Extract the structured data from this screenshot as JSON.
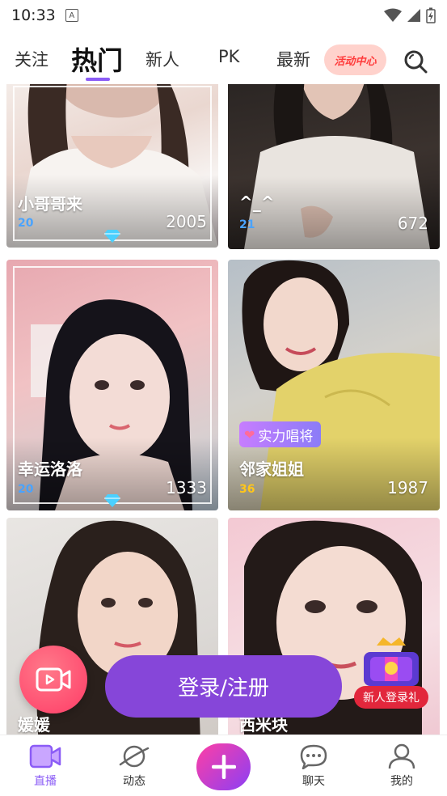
{
  "status": {
    "time": "10:33",
    "a_icon": "A"
  },
  "nav": {
    "tabs": [
      "关注",
      "热门",
      "新人",
      "PK",
      "最新"
    ],
    "active_tab": "热门",
    "event_label": "活动中心"
  },
  "cards": [
    {
      "name": "小哥哥来",
      "level": "20",
      "viewers": "2005",
      "level_color": "#4aa3ff"
    },
    {
      "name": "^_^",
      "level": "21",
      "viewers": "672",
      "level_color": "#4aa3ff"
    },
    {
      "name": "幸运洛洛",
      "level": "20",
      "viewers": "1333",
      "level_color": "#4aa3ff"
    },
    {
      "name": "邻家姐姐",
      "level": "36",
      "viewers": "1987",
      "level_color": "#ffc61a",
      "tag": "实力唱将"
    },
    {
      "name": "媛媛",
      "level": "",
      "viewers": "",
      "level_color": "#4aa3ff"
    },
    {
      "name": "西米块",
      "level": "",
      "viewers": "",
      "level_color": "#4aa3ff"
    }
  ],
  "login_label": "登录/注册",
  "gift_label": "新人登录礼",
  "bottom_nav": [
    {
      "label": "直播",
      "icon": "live-video-icon"
    },
    {
      "label": "动态",
      "icon": "planet-icon"
    },
    {
      "label": "",
      "icon": "plus-icon"
    },
    {
      "label": "聊天",
      "icon": "chat-bubble-icon"
    },
    {
      "label": "我的",
      "icon": "profile-icon"
    }
  ],
  "colors": {
    "accent": "#8b5cf6",
    "login": "#8646d9",
    "event_bg": "#ffd2cc"
  }
}
